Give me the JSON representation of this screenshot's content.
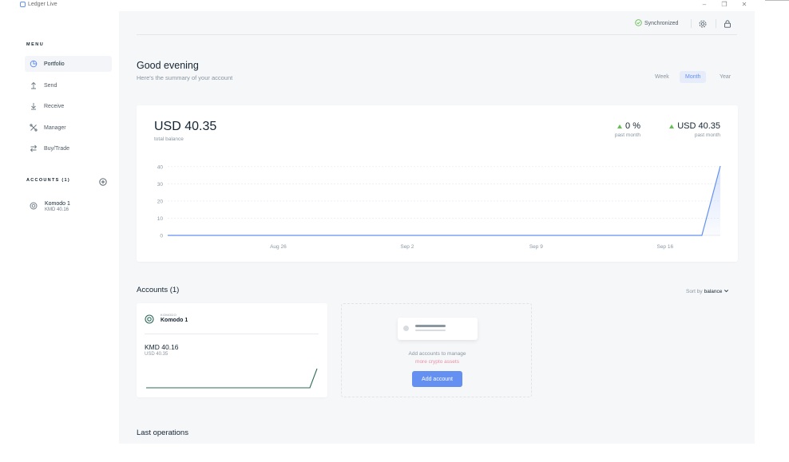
{
  "window": {
    "title": "Ledger Live",
    "controls": [
      "–",
      "❐",
      "✕"
    ]
  },
  "sidebar": {
    "menu_title": "MENU",
    "items": [
      {
        "label": "Portfolio",
        "icon": "pie-chart-icon",
        "active": true
      },
      {
        "label": "Send",
        "icon": "arrow-up-icon",
        "active": false
      },
      {
        "label": "Receive",
        "icon": "arrow-down-icon",
        "active": false
      },
      {
        "label": "Manager",
        "icon": "tools-icon",
        "active": false
      },
      {
        "label": "Buy/Trade",
        "icon": "swap-icon",
        "active": false
      }
    ],
    "accounts_title": "ACCOUNTS (1)",
    "accounts": [
      {
        "name": "Komodo 1",
        "balance": "KMD 40.16"
      }
    ]
  },
  "header": {
    "sync_label": "Synchronized"
  },
  "main": {
    "greeting": "Good evening",
    "subtitle": "Here's the summary of your account",
    "ranges": [
      {
        "label": "Week",
        "active": false
      },
      {
        "label": "Month",
        "active": true
      },
      {
        "label": "Year",
        "active": false
      }
    ],
    "balance": "USD 40.35",
    "balance_label": "total balance",
    "stats": [
      {
        "value": "0 %",
        "label": "past month"
      },
      {
        "value": "USD 40.35",
        "label": "past month"
      }
    ],
    "accounts_heading": "Accounts (1)",
    "sort_prefix": "Sort by",
    "sort_value": "balance",
    "account_card": {
      "ticker": "KOMODO",
      "name": "Komodo 1",
      "amount": "KMD 40.16",
      "usd": "USD 40.35"
    },
    "add_card": {
      "line1": "Add accounts to manage",
      "line2": "more crypto assets",
      "button": "Add account"
    },
    "last_ops": "Last operations"
  },
  "colors": {
    "accent": "#6490f1",
    "positive": "#66be54",
    "account_line": "#2d6b5b"
  },
  "chart_data": {
    "type": "area",
    "x": [
      "Aug 20",
      "Aug 21",
      "Aug 22",
      "Aug 23",
      "Aug 24",
      "Aug 25",
      "Aug 26",
      "Aug 27",
      "Aug 28",
      "Aug 29",
      "Aug 30",
      "Aug 31",
      "Sep 1",
      "Sep 2",
      "Sep 3",
      "Sep 4",
      "Sep 5",
      "Sep 6",
      "Sep 7",
      "Sep 8",
      "Sep 9",
      "Sep 10",
      "Sep 11",
      "Sep 12",
      "Sep 13",
      "Sep 14",
      "Sep 15",
      "Sep 16",
      "Sep 17",
      "Sep 18",
      "Sep 19"
    ],
    "values": [
      0,
      0,
      0,
      0,
      0,
      0,
      0,
      0,
      0,
      0,
      0,
      0,
      0,
      0,
      0,
      0,
      0,
      0,
      0,
      0,
      0,
      0,
      0,
      0,
      0,
      0,
      0,
      0,
      0,
      0,
      40.35
    ],
    "xticks": [
      "Aug 26",
      "Sep 2",
      "Sep 9",
      "Sep 16"
    ],
    "yticks": [
      0,
      10,
      20,
      30,
      40
    ],
    "ylim": [
      0,
      40.35
    ],
    "grid": true,
    "color": "#6490f1"
  }
}
